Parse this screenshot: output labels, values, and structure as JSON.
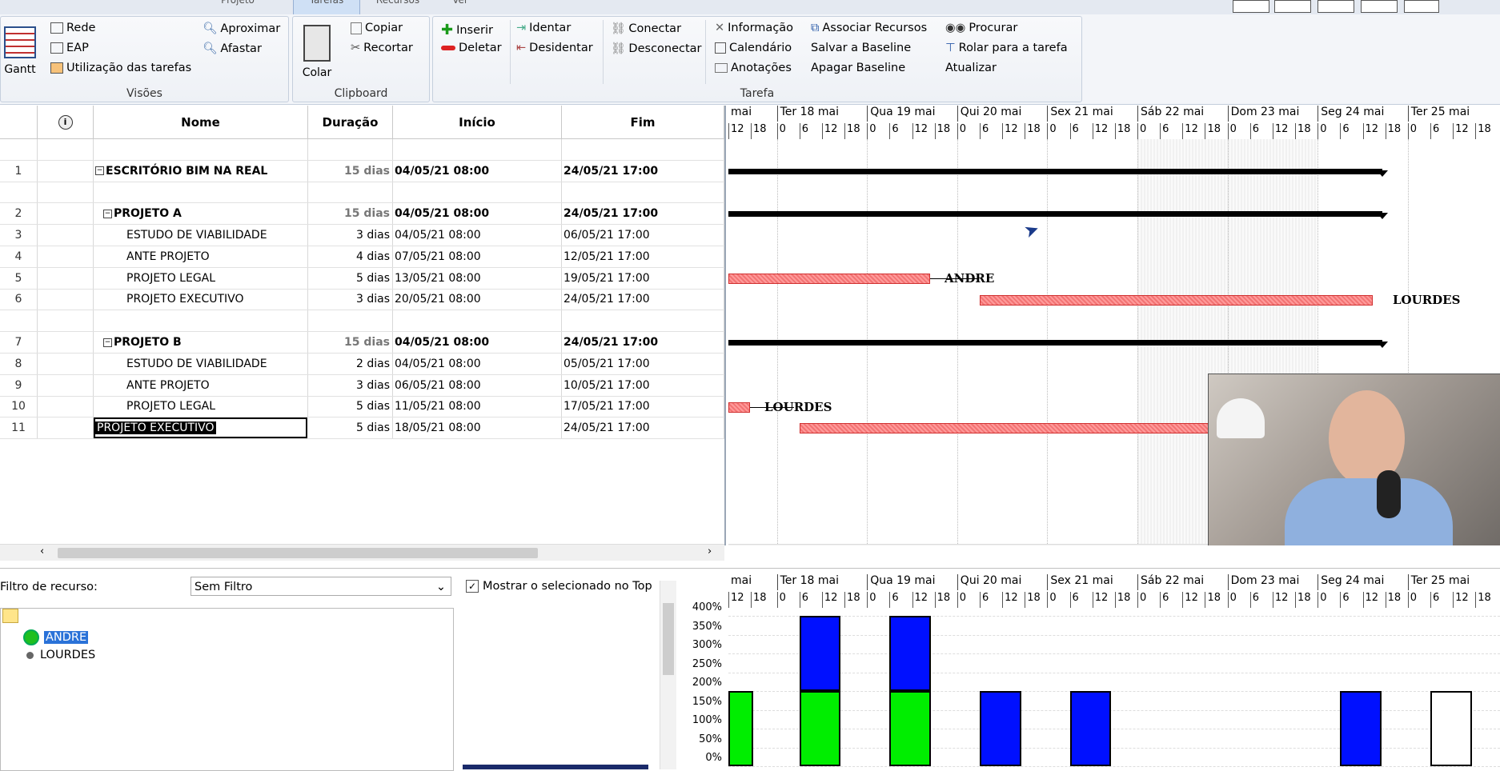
{
  "tabs": [
    "Projeto",
    "Tarefas",
    "Recursos",
    "Ver"
  ],
  "ribbon": {
    "visoes": {
      "label": "Visões",
      "gantt": "Gantt",
      "rede": "Rede",
      "eap": "EAP",
      "utilizacao": "Utilização das tarefas",
      "aproximar": "Aproximar",
      "afastar": "Afastar"
    },
    "clipboard": {
      "label": "Clipboard",
      "colar": "Colar",
      "copiar": "Copiar",
      "recortar": "Recortar"
    },
    "tarefa": {
      "label": "Tarefa",
      "inserir": "Inserir",
      "deletar": "Deletar",
      "identar": "Identar",
      "desidentar": "Desidentar",
      "conectar": "Conectar",
      "desconectar": "Desconectar",
      "informacao": "Informação",
      "calendario": "Calendário",
      "anotacoes": "Anotações",
      "associar": "Associar Recursos",
      "salvar_baseline": "Salvar a Baseline",
      "apagar_baseline": "Apagar Baseline",
      "procurar": "Procurar",
      "rolar": "Rolar para a tarefa",
      "atualizar": "Atualizar"
    }
  },
  "columns": {
    "nome": "Nome",
    "duracao": "Duração",
    "inicio": "Início",
    "fim": "Fim"
  },
  "rows": [
    {
      "id": "",
      "name": "",
      "dur": "",
      "ini": "",
      "fim": "",
      "type": "blank"
    },
    {
      "id": "1",
      "name": "ESCRITÓRIO BIM NA REAL",
      "dur": "15 dias",
      "ini": "04/05/21 08:00",
      "fim": "24/05/21 17:00",
      "type": "summary",
      "indent": 0
    },
    {
      "id": "",
      "name": "",
      "dur": "",
      "ini": "",
      "fim": "",
      "type": "blank"
    },
    {
      "id": "2",
      "name": "PROJETO A",
      "dur": "15 dias",
      "ini": "04/05/21 08:00",
      "fim": "24/05/21 17:00",
      "type": "summary",
      "indent": 1
    },
    {
      "id": "3",
      "name": "ESTUDO DE VIABILIDADE",
      "dur": "3 dias",
      "ini": "04/05/21 08:00",
      "fim": "06/05/21 17:00",
      "type": "task"
    },
    {
      "id": "4",
      "name": "ANTE PROJETO",
      "dur": "4 dias",
      "ini": "07/05/21 08:00",
      "fim": "12/05/21 17:00",
      "type": "task"
    },
    {
      "id": "5",
      "name": "PROJETO LEGAL",
      "dur": "5 dias",
      "ini": "13/05/21 08:00",
      "fim": "19/05/21 17:00",
      "type": "task"
    },
    {
      "id": "6",
      "name": "PROJETO EXECUTIVO",
      "dur": "3 dias",
      "ini": "20/05/21 08:00",
      "fim": "24/05/21 17:00",
      "type": "task"
    },
    {
      "id": "",
      "name": "",
      "dur": "",
      "ini": "",
      "fim": "",
      "type": "blank"
    },
    {
      "id": "7",
      "name": "PROJETO B",
      "dur": "15 dias",
      "ini": "04/05/21 08:00",
      "fim": "24/05/21 17:00",
      "type": "summary",
      "indent": 1
    },
    {
      "id": "8",
      "name": "ESTUDO DE VIABILIDADE",
      "dur": "2 dias",
      "ini": "04/05/21 08:00",
      "fim": "05/05/21 17:00",
      "type": "task"
    },
    {
      "id": "9",
      "name": "ANTE PROJETO",
      "dur": "3 dias",
      "ini": "06/05/21 08:00",
      "fim": "10/05/21 17:00",
      "type": "task"
    },
    {
      "id": "10",
      "name": "PROJETO LEGAL",
      "dur": "5 dias",
      "ini": "11/05/21 08:00",
      "fim": "17/05/21 17:00",
      "type": "task"
    },
    {
      "id": "11",
      "name": "PROJETO EXECUTIVO",
      "dur": "5 dias",
      "ini": "18/05/21 08:00",
      "fim": "24/05/21 17:00",
      "type": "task",
      "editing": true
    }
  ],
  "timeline": {
    "days": [
      "mai",
      "Ter 18 mai",
      "Qua 19 mai",
      "Qui 20 mai",
      "Sex 21 mai",
      "Sáb 22 mai",
      "Dom 23 mai",
      "Seg 24 mai",
      "Ter 25 mai"
    ],
    "hours": [
      "0",
      "6",
      "12",
      "18"
    ],
    "first_hours": [
      "12",
      "18"
    ]
  },
  "gantt_labels": {
    "andre": "ANDRE",
    "lourdes1": "LOURDES",
    "lourdes2": "LOURDES"
  },
  "resource_panel": {
    "filter_label": "Filtro de recurso:",
    "filter_value": "Sem Filtro",
    "show_selected": "Mostrar o selecionado no Top",
    "resources": [
      "ANDRE",
      "LOURDES"
    ]
  },
  "histogram": {
    "y_ticks": [
      "400%",
      "350%",
      "300%",
      "250%",
      "200%",
      "150%",
      "100%",
      "50%",
      "0%"
    ],
    "colors": {
      "green": "#00ee00",
      "blue": "#0010ff"
    },
    "bars": [
      {
        "day_index": 0,
        "start_hour": 12,
        "end_hour": 18,
        "green": 200,
        "blue": 0
      },
      {
        "day_index": 1,
        "start_hour": 6,
        "end_hour": 17,
        "green": 200,
        "blue": 200
      },
      {
        "day_index": 2,
        "start_hour": 6,
        "end_hour": 17,
        "green": 200,
        "blue": 200
      },
      {
        "day_index": 3,
        "start_hour": 6,
        "end_hour": 17,
        "green": 0,
        "blue": 200
      },
      {
        "day_index": 4,
        "start_hour": 6,
        "end_hour": 17,
        "green": 0,
        "blue": 200
      },
      {
        "day_index": 7,
        "start_hour": 6,
        "end_hour": 17,
        "green": 0,
        "blue": 200
      },
      {
        "day_index": 8,
        "start_hour": 6,
        "end_hour": 17,
        "green": 0,
        "blue": 0,
        "outline": 200
      }
    ]
  }
}
